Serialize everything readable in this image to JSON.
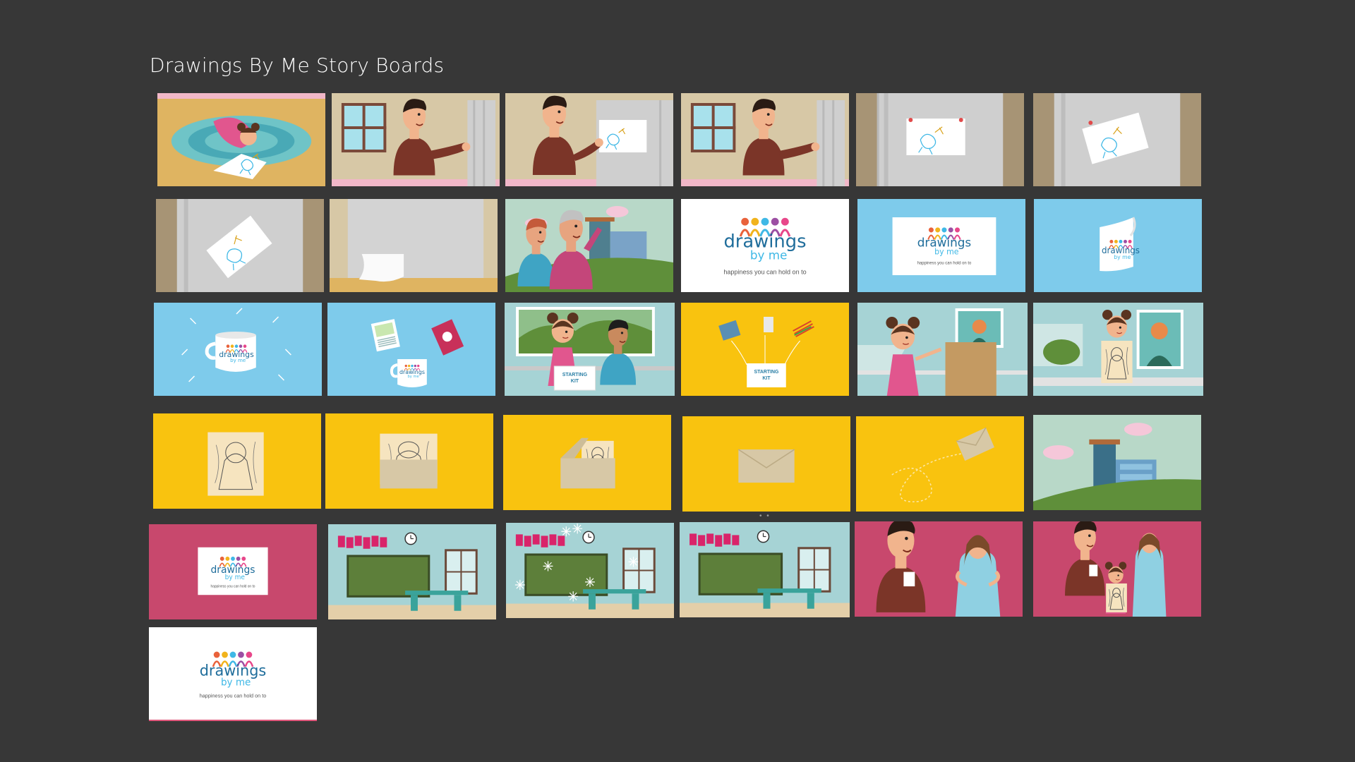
{
  "page": {
    "title": "Drawings By Me Story Boards"
  },
  "brand": {
    "word1": "drawings",
    "word2": "by me",
    "tagline": "happiness you can hold on to",
    "kit_line1": "STARTING",
    "kit_line2": "KIT"
  },
  "colors": {
    "background": "#373737",
    "sky": "#7ecbeb",
    "yellow": "#f9c30f",
    "magenta": "#c8486d",
    "wall": "#d7c8a6",
    "fridge": "#cfcfcf",
    "shirt": "#7b3528"
  },
  "boards": [
    {
      "id": 1,
      "scene": "girl-drawing-on-rug"
    },
    {
      "id": 2,
      "scene": "dad-at-fridge"
    },
    {
      "id": 3,
      "scene": "dad-places-drawing-on-fridge"
    },
    {
      "id": 4,
      "scene": "dad-at-fridge"
    },
    {
      "id": 5,
      "scene": "drawing-on-fridge"
    },
    {
      "id": 6,
      "scene": "drawing-tilted-on-fridge"
    },
    {
      "id": 7,
      "scene": "drawing-falling"
    },
    {
      "id": 8,
      "scene": "paper-fallen"
    },
    {
      "id": 9,
      "scene": "family-outside-building"
    },
    {
      "id": 10,
      "scene": "logo-white"
    },
    {
      "id": 11,
      "scene": "logo-card-on-blue"
    },
    {
      "id": 12,
      "scene": "curling-card-on-blue"
    },
    {
      "id": 13,
      "scene": "mug-on-blue"
    },
    {
      "id": 14,
      "scene": "products-on-blue"
    },
    {
      "id": 15,
      "scene": "kids-with-starting-kit"
    },
    {
      "id": 16,
      "scene": "starting-kit-on-yellow"
    },
    {
      "id": 17,
      "scene": "girl-drawing-at-desk"
    },
    {
      "id": 18,
      "scene": "girl-shows-drawing"
    },
    {
      "id": 19,
      "scene": "drawing-on-yellow"
    },
    {
      "id": 20,
      "scene": "drawing-into-envelope"
    },
    {
      "id": 21,
      "scene": "envelope-closing"
    },
    {
      "id": 22,
      "scene": "envelope-sealed"
    },
    {
      "id": 23,
      "scene": "envelope-flying"
    },
    {
      "id": 24,
      "scene": "building-exterior"
    },
    {
      "id": 25,
      "scene": "logo-card-on-magenta"
    },
    {
      "id": 26,
      "scene": "classroom"
    },
    {
      "id": 27,
      "scene": "classroom-sparkles"
    },
    {
      "id": 28,
      "scene": "classroom"
    },
    {
      "id": 29,
      "scene": "parents-with-products"
    },
    {
      "id": 30,
      "scene": "family-with-products"
    },
    {
      "id": 31,
      "scene": "logo-white-end"
    }
  ]
}
